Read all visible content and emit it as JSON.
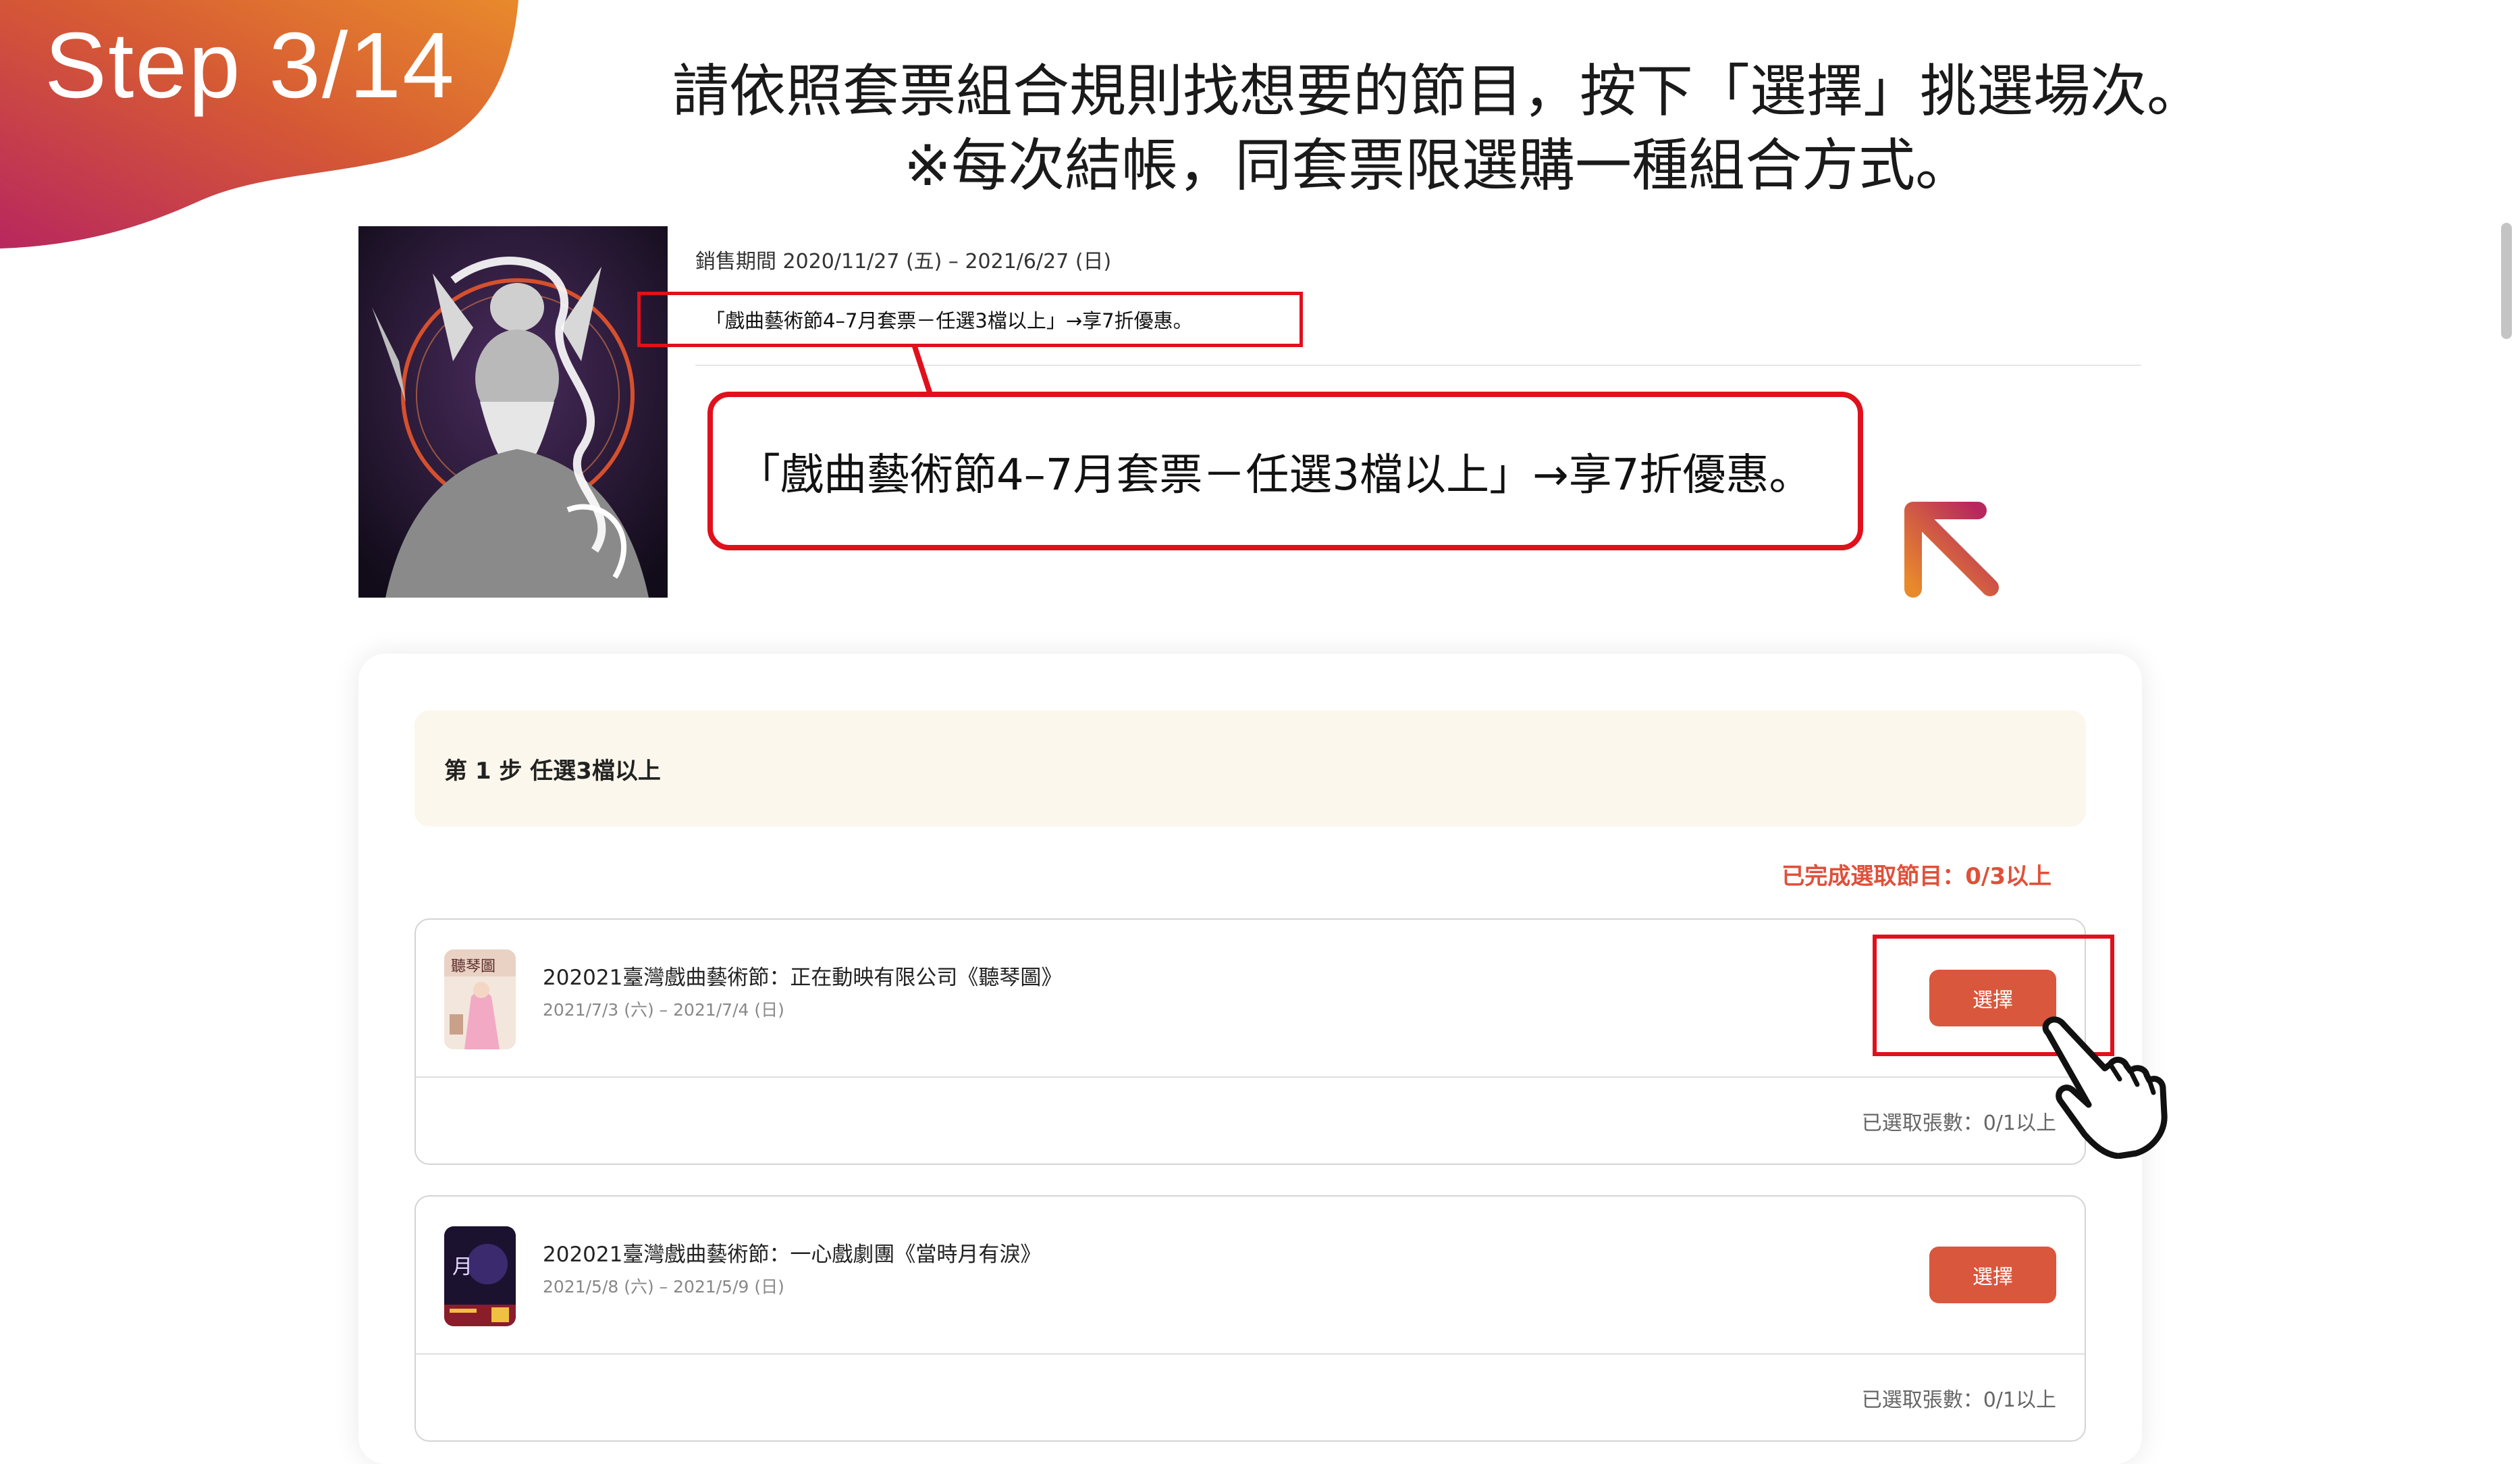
{
  "step_badge": {
    "label": "Step 3/14",
    "gradient_colors": [
      "#b8275e",
      "#d65a34",
      "#e88a2c"
    ]
  },
  "instructions": {
    "line1": "請依照套票組合規則找想要的節目，按下「選擇」挑選場次。",
    "line2": "※每次結帳，同套票限選購一種組合方式。"
  },
  "product": {
    "poster_icon": "opera-performer-poster",
    "sale_period": "銷售期間 2020/11/27 (五) – 2021/6/27 (日)",
    "promo_text": "「戲曲藝術節4–7月套票－任選3檔以上」→享7折優惠。",
    "callout_text": "「戲曲藝術節4–7月套票－任選3檔以上」→享7折優惠。"
  },
  "step": {
    "title": "第 1 步  任選3檔以上",
    "completion_status": "已完成選取節目：0/3以上"
  },
  "programs": [
    {
      "title": "202021臺灣戲曲藝術節：正在動映有限公司《聽琴圖》",
      "dates": "2021/7/3 (六) – 2021/7/4 (日)",
      "button_label": "選擇",
      "tickets": "已選取張數：0/1以上",
      "thumb_icon": "ting-qin-tu-poster"
    },
    {
      "title": "202021臺灣戲曲藝術節：一心戲劇團《當時月有淚》",
      "dates": "2021/5/8 (六) – 2021/5/9 (日)",
      "button_label": "選擇",
      "tickets": "已選取張數：0/1以上",
      "thumb_icon": "moon-tears-poster"
    }
  ],
  "annotations": {
    "highlight_color": "#e0101d",
    "button_color": "#d9573d",
    "status_color": "#e0503a",
    "arrow_icon": "diagonal-arrow-up-left-icon",
    "cursor_icon": "hand-pointer-icon"
  }
}
